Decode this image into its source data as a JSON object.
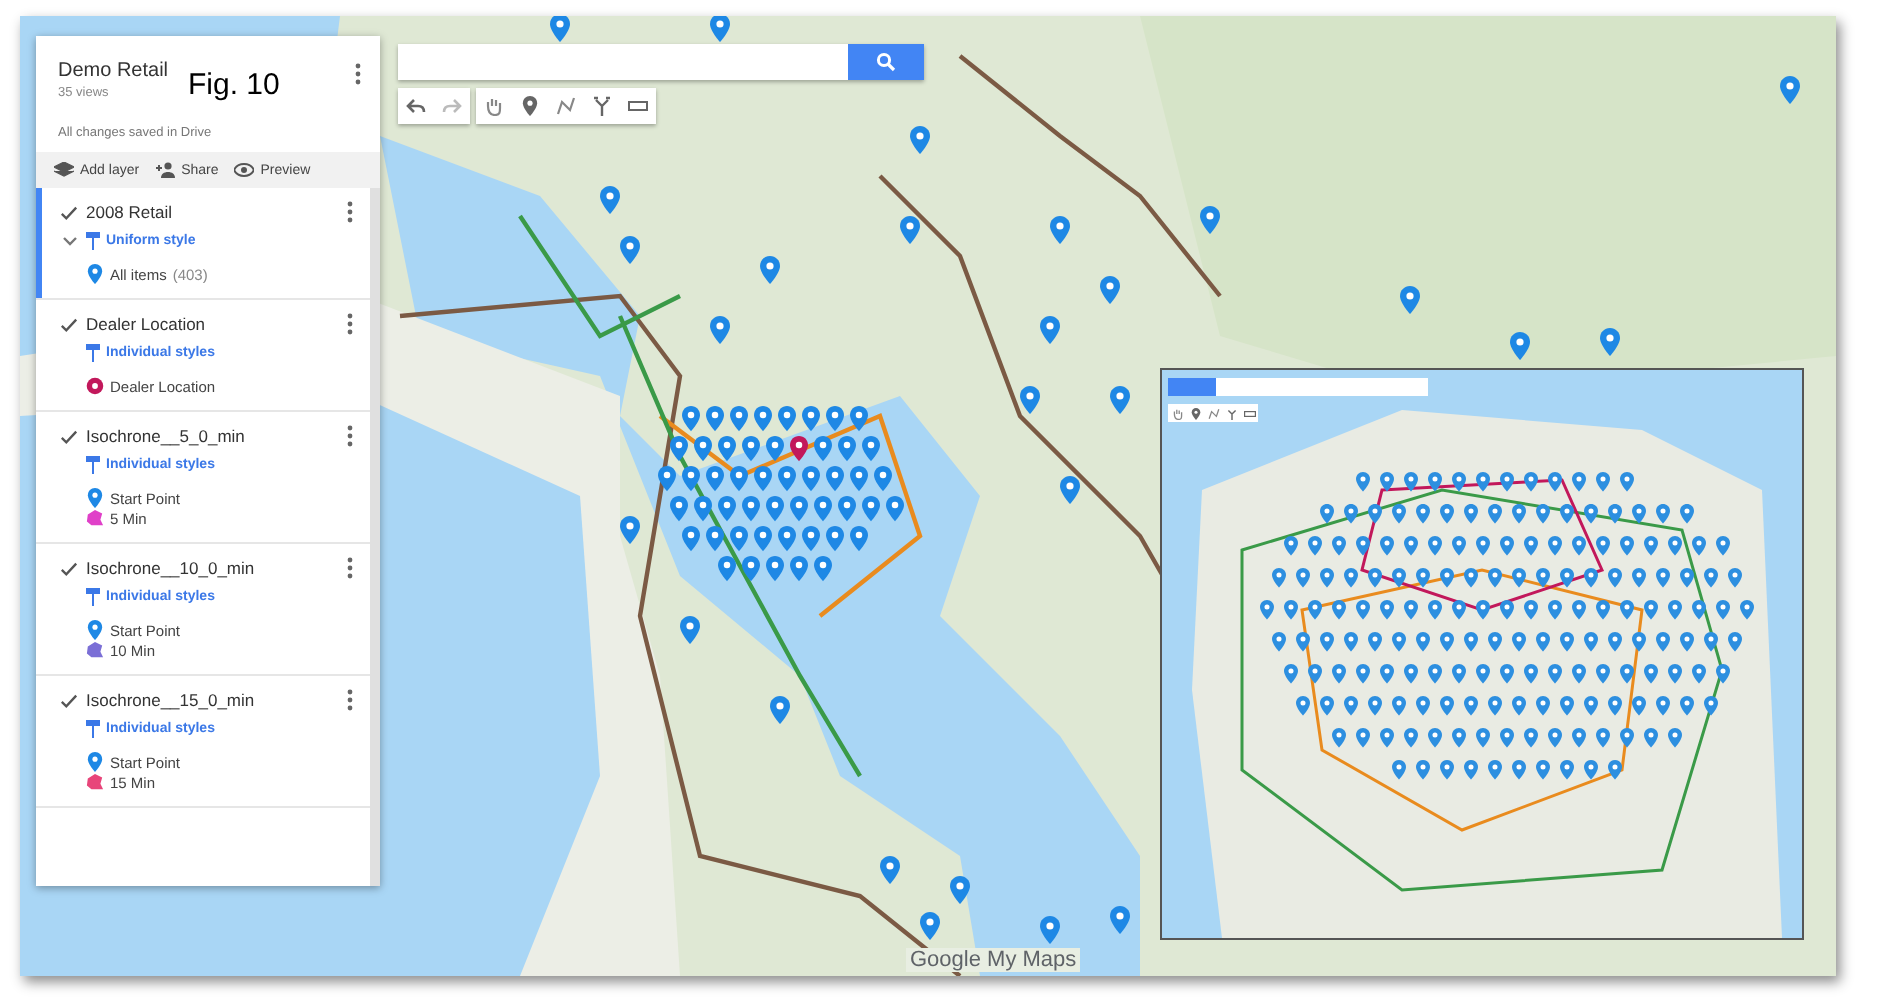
{
  "sidebar": {
    "title": "Demo Retail",
    "views": "35 views",
    "save_status": "All changes saved in Drive",
    "actions": [
      {
        "kind": "add-layer",
        "label": "Add layer"
      },
      {
        "kind": "share",
        "label": "Share"
      },
      {
        "kind": "preview",
        "label": "Preview"
      }
    ],
    "layers": [
      {
        "name": "2008 Retail",
        "checked": true,
        "selected": true,
        "expanded": true,
        "style": "Uniform style",
        "items": [
          {
            "kind": "pin",
            "label": "All items",
            "count": "(403)",
            "color": "#1e88e5"
          }
        ]
      },
      {
        "name": "Dealer Location",
        "checked": true,
        "selected": false,
        "expanded": false,
        "style": "Individual styles",
        "items": [
          {
            "kind": "dot",
            "label": "Dealer Location",
            "color": "#c2185b"
          }
        ]
      },
      {
        "name": "Isochrone__5_0_min",
        "checked": true,
        "selected": false,
        "expanded": false,
        "style": "Individual styles",
        "items": [
          {
            "kind": "pin",
            "label": "Start Point",
            "color": "#1e88e5"
          },
          {
            "kind": "polygon",
            "label": "5 Min",
            "color": "#e040c8"
          }
        ]
      },
      {
        "name": "Isochrone__10_0_min",
        "checked": true,
        "selected": false,
        "expanded": false,
        "style": "Individual styles",
        "items": [
          {
            "kind": "pin",
            "label": "Start Point",
            "color": "#1e88e5"
          },
          {
            "kind": "polygon",
            "label": "10 Min",
            "color": "#7b6fd6"
          }
        ]
      },
      {
        "name": "Isochrone__15_0_min",
        "checked": true,
        "selected": false,
        "expanded": false,
        "style": "Individual styles",
        "items": [
          {
            "kind": "pin",
            "label": "Start Point",
            "color": "#1e88e5"
          },
          {
            "kind": "polygon",
            "label": "15 Min",
            "color": "#e8457a"
          }
        ]
      }
    ]
  },
  "annotation": "Fig. 10",
  "map_logo": "Google My Maps"
}
